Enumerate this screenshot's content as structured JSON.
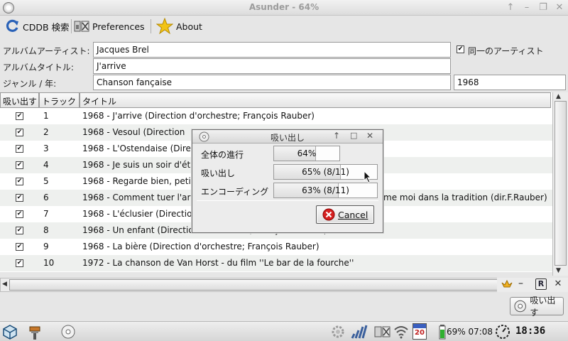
{
  "window": {
    "title": "Asunder - 64%"
  },
  "toolbar": {
    "cddb_label": "CDDB 検索",
    "prefs_label": "Preferences",
    "about_label": "About"
  },
  "form": {
    "artist_label": "アルバムアーティスト:",
    "artist_value": "Jacques Brel",
    "same_artist_label": "同一のアーティスト",
    "same_artist_checked": true,
    "album_label": "アルバムタイトル:",
    "album_value": "J'arrive",
    "genre_year_label": "ジャンル / 年:",
    "genre_value": "Chanson fançaise",
    "year_value": "1968"
  },
  "table": {
    "headers": {
      "rip": "吸い出す",
      "track": "トラック",
      "title": "タイトル"
    },
    "rows": [
      {
        "checked": true,
        "num": "1",
        "title": "1968 - J'arrive  (Direction d'orchestre; François Rauber)"
      },
      {
        "checked": true,
        "num": "2",
        "title": "1968 - Vesoul  (Direction"
      },
      {
        "checked": true,
        "num": "3",
        "title": "1968 - L'Ostendaise  (Dire"
      },
      {
        "checked": true,
        "num": "4",
        "title": "1968 - Je suis un soir d'ét"
      },
      {
        "checked": true,
        "num": "5",
        "title": "1968 - Regarde bien, peti"
      },
      {
        "checked": true,
        "num": "6",
        "title": "1968 - Comment tuer l'ar",
        "title_right": "me moi dans la tradition (dir.F.Rauber)"
      },
      {
        "checked": true,
        "num": "7",
        "title": "1968 - L'éclusier  (Directio"
      },
      {
        "checked": true,
        "num": "8",
        "title": "1968 - Un enfant  (Direction d'orchestre; François Rauber)"
      },
      {
        "checked": true,
        "num": "9",
        "title": "1968 - La bière  (Direction d'orchestre; François Rauber)"
      },
      {
        "checked": true,
        "num": "10",
        "title": "1972 - La chanson de Van Horst - du film ''Le bar de la fourche''"
      }
    ]
  },
  "rip_button": {
    "label": "吸い出す"
  },
  "dialog": {
    "title": "吸い出し",
    "overall_label": "全体の進行",
    "overall_text": "64%",
    "overall_fraction": 0.64,
    "rip_label": "吸い出し",
    "rip_text": "65% (8/11)",
    "rip_fraction": 0.65,
    "encode_label": "エンコーディング",
    "encode_text": "63% (8/11)",
    "encode_fraction": 0.63,
    "cancel_label": "Cancel"
  },
  "taskbar": {
    "battery_text": "69% 07:08",
    "clock": "18:36",
    "calendar_day": "20"
  }
}
